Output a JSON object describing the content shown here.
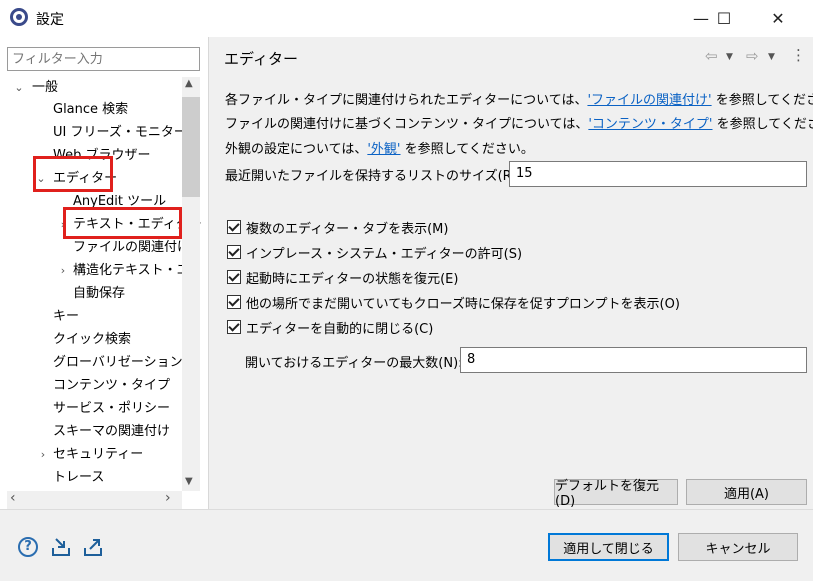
{
  "window": {
    "title": "設定",
    "minimize": "—",
    "maximize": "☐",
    "close": "✕"
  },
  "filter": {
    "placeholder": "フィルター入力"
  },
  "tree": [
    {
      "label": "一般",
      "twisty": "⌄"
    },
    {
      "label": "Glance 検索"
    },
    {
      "label": "UI フリーズ・モニター"
    },
    {
      "label": "Web ブラウザー"
    },
    {
      "label": "エディター",
      "twisty": "⌄"
    },
    {
      "label": "AnyEdit ツール"
    },
    {
      "label": "テキスト・エディター",
      "twisty": "›"
    },
    {
      "label": "ファイルの関連付け"
    },
    {
      "label": "構造化テキスト・エ",
      "twisty": "›"
    },
    {
      "label": "自動保存"
    },
    {
      "label": "キー"
    },
    {
      "label": "クイック検索"
    },
    {
      "label": "グローバリゼーション"
    },
    {
      "label": "コンテンツ・タイプ"
    },
    {
      "label": "サービス・ポリシー"
    },
    {
      "label": "スキーマの関連付け"
    },
    {
      "label": "セキュリティー",
      "twisty": "›"
    },
    {
      "label": "トレース"
    }
  ],
  "page": {
    "title": "エディター",
    "nav": {
      "back": "⇦",
      "forward": "⇨",
      "menu": "⋮"
    },
    "line1": {
      "pre": "各ファイル・タイプに関連付けられたエディターについては、",
      "link": "'ファイルの関連付け'",
      "post": " を参照してください。"
    },
    "line2": {
      "pre": "ファイルの関連付けに基づくコンテンツ・タイプについては、",
      "link": "'コンテンツ・タイプ'",
      "post": " を参照してください。"
    },
    "line3": {
      "pre": "外観の設定については、",
      "link": "'外観'",
      "post": " を参照してください。"
    },
    "recent_label": "最近開いたファイルを保持するリストのサイズ(R):",
    "recent_value": "15",
    "checkboxes": [
      {
        "label": "複数のエディター・タブを表示(M)",
        "checked": true
      },
      {
        "label": "インプレース・システム・エディターの許可(S)",
        "checked": true
      },
      {
        "label": "起動時にエディターの状態を復元(E)",
        "checked": true
      },
      {
        "label": "他の場所でまだ開いていてもクローズ時に保存を促すプロンプトを表示(O)",
        "checked": true
      },
      {
        "label": "エディターを自動的に閉じる(C)",
        "checked": true
      }
    ],
    "max_label": "開いておけるエディターの最大数(N):",
    "max_value": "8",
    "restore_defaults": "デフォルトを復元(D)",
    "apply": "適用(A)"
  },
  "footer": {
    "apply_close": "適用して閉じる",
    "cancel": "キャンセル",
    "help_icon": "?",
    "import_icon": "import-icon",
    "export_icon": "export-icon"
  }
}
